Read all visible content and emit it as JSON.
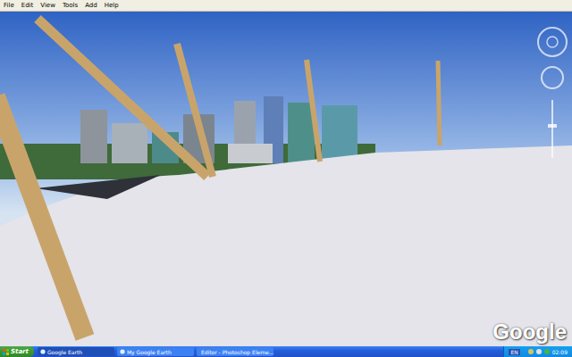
{
  "menu": [
    "File",
    "Edit",
    "View",
    "Tools",
    "Add",
    "Help"
  ],
  "view": {
    "watermark": "Google"
  },
  "taskbar": {
    "start": "Start",
    "tasks": [
      {
        "label": "Google Earth",
        "selected": true
      },
      {
        "label": "My Google Earth",
        "selected": false
      },
      {
        "label": "Editor - Photoshop Eleme...",
        "selected": false
      }
    ],
    "language": "EN",
    "clock": "02:09"
  }
}
